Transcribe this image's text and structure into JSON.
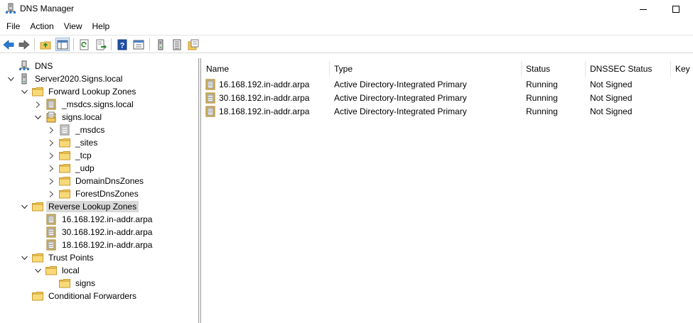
{
  "window": {
    "title": "DNS Manager",
    "icon": "dns-server-icon"
  },
  "menu": [
    "File",
    "Action",
    "View",
    "Help"
  ],
  "toolbar": {
    "buttons": [
      "back-arrow-icon",
      "forward-arrow-icon",
      "up-folder-icon",
      "show-hide-tree-icon",
      "refresh-icon",
      "export-list-icon",
      "help-icon",
      "properties-icon",
      "server-icon",
      "zone-list-icon",
      "new-zone-icon"
    ]
  },
  "tree": [
    {
      "label": "DNS",
      "level": 0,
      "expander": "none",
      "icon": "dns-root-icon"
    },
    {
      "label": "Server2020.Signs.local",
      "level": 0,
      "expander": "expanded",
      "icon": "server-icon"
    },
    {
      "label": "Forward Lookup Zones",
      "level": 1,
      "expander": "expanded",
      "icon": "folder-icon"
    },
    {
      "label": "_msdcs.signs.local",
      "level": 2,
      "expander": "collapsed",
      "icon": "zone-icon"
    },
    {
      "label": "signs.local",
      "level": 2,
      "expander": "expanded",
      "icon": "zone-open-icon"
    },
    {
      "label": "_msdcs",
      "level": 3,
      "expander": "collapsed",
      "icon": "delegated-zone-icon"
    },
    {
      "label": "_sites",
      "level": 3,
      "expander": "collapsed",
      "icon": "folder-icon"
    },
    {
      "label": "_tcp",
      "level": 3,
      "expander": "collapsed",
      "icon": "folder-icon"
    },
    {
      "label": "_udp",
      "level": 3,
      "expander": "collapsed",
      "icon": "folder-icon"
    },
    {
      "label": "DomainDnsZones",
      "level": 3,
      "expander": "collapsed",
      "icon": "folder-icon"
    },
    {
      "label": "ForestDnsZones",
      "level": 3,
      "expander": "collapsed",
      "icon": "folder-icon"
    },
    {
      "label": "Reverse Lookup Zones",
      "level": 1,
      "expander": "expanded",
      "icon": "folder-icon",
      "selected": true
    },
    {
      "label": "16.168.192.in-addr.arpa",
      "level": 2,
      "expander": "none",
      "icon": "zone-icon"
    },
    {
      "label": "30.168.192.in-addr.arpa",
      "level": 2,
      "expander": "none",
      "icon": "zone-icon"
    },
    {
      "label": "18.168.192.in-addr.arpa",
      "level": 2,
      "expander": "none",
      "icon": "zone-icon"
    },
    {
      "label": "Trust Points",
      "level": 1,
      "expander": "expanded",
      "icon": "folder-icon"
    },
    {
      "label": "local",
      "level": 2,
      "expander": "expanded",
      "icon": "folder-icon"
    },
    {
      "label": "signs",
      "level": 3,
      "expander": "none",
      "icon": "folder-icon"
    },
    {
      "label": "Conditional Forwarders",
      "level": 1,
      "expander": "none",
      "icon": "folder-icon"
    }
  ],
  "list": {
    "columns": [
      "Name",
      "Type",
      "Status",
      "DNSSEC Status",
      "Key M"
    ],
    "rows": [
      [
        "16.168.192.in-addr.arpa",
        "Active Directory-Integrated Primary",
        "Running",
        "Not Signed"
      ],
      [
        "30.168.192.in-addr.arpa",
        "Active Directory-Integrated Primary",
        "Running",
        "Not Signed"
      ],
      [
        "18.168.192.in-addr.arpa",
        "Active Directory-Integrated Primary",
        "Running",
        "Not Signed"
      ]
    ]
  },
  "colors": {
    "folder": "#f0c85a",
    "folder_edge": "#c99a2e",
    "selection": "#d9d9d9",
    "toolbar_arrow": "#2a7ad4"
  }
}
